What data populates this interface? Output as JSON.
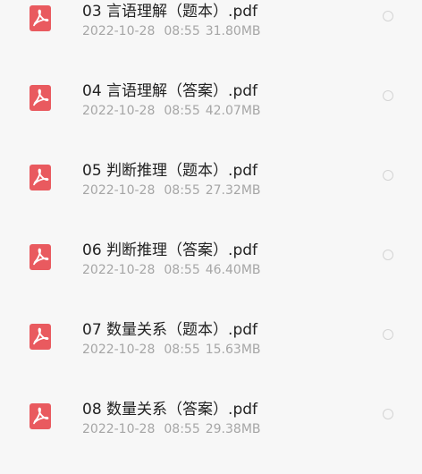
{
  "files": [
    {
      "name": "03 言语理解（题本）.pdf",
      "date": "2022-10-28",
      "time": "08:55",
      "size": "31.80MB",
      "icon": "pdf-icon"
    },
    {
      "name": "04 言语理解（答案）.pdf",
      "date": "2022-10-28",
      "time": "08:55",
      "size": "42.07MB",
      "icon": "pdf-icon"
    },
    {
      "name": "05 判断推理（题本）.pdf",
      "date": "2022-10-28",
      "time": "08:55",
      "size": "27.32MB",
      "icon": "pdf-icon"
    },
    {
      "name": "06 判断推理（答案）.pdf",
      "date": "2022-10-28",
      "time": "08:55",
      "size": "46.40MB",
      "icon": "pdf-icon"
    },
    {
      "name": "07 数量关系（题本）.pdf",
      "date": "2022-10-28",
      "time": "08:55",
      "size": "15.63MB",
      "icon": "pdf-icon"
    },
    {
      "name": "08 数量关系（答案）.pdf",
      "date": "2022-10-28",
      "time": "08:55",
      "size": "29.38MB",
      "icon": "pdf-icon"
    }
  ],
  "colors": {
    "pdf_icon": "#e95a5f",
    "background": "#f7f7f7",
    "name_text": "#222222",
    "meta_text": "#a6a6a6",
    "radio_border": "#d4d4d4"
  }
}
